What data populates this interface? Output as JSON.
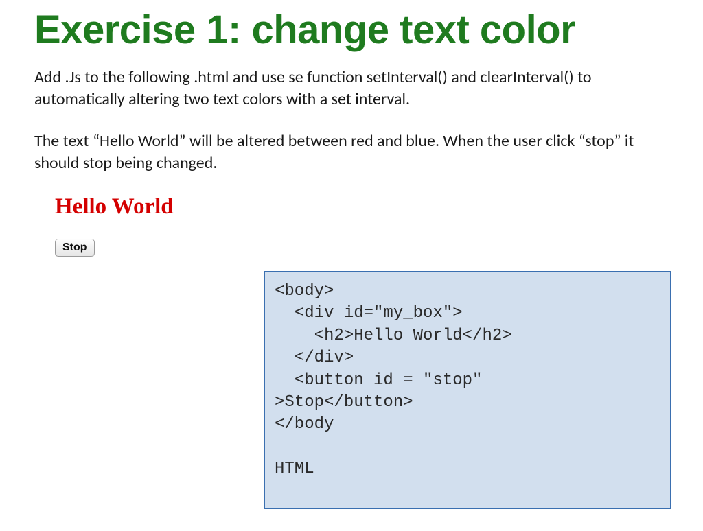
{
  "title": "Exercise 1: change text color",
  "para1": "Add .Js to the following .html  and use se function setInterval() and clearInterval() to automatically altering two text colors with a set interval.",
  "para2": "The text “Hello World” will be altered between red and blue. When the user click “stop” it should stop being changed.",
  "hello_text": "Hello World",
  "stop_label": "Stop",
  "code": "<body>\n  <div id=\"my_box\">\n    <h2>Hello World</h2>\n  </div>\n  <button id = \"stop\" \n>Stop</button>\n</body\n\nHTML"
}
